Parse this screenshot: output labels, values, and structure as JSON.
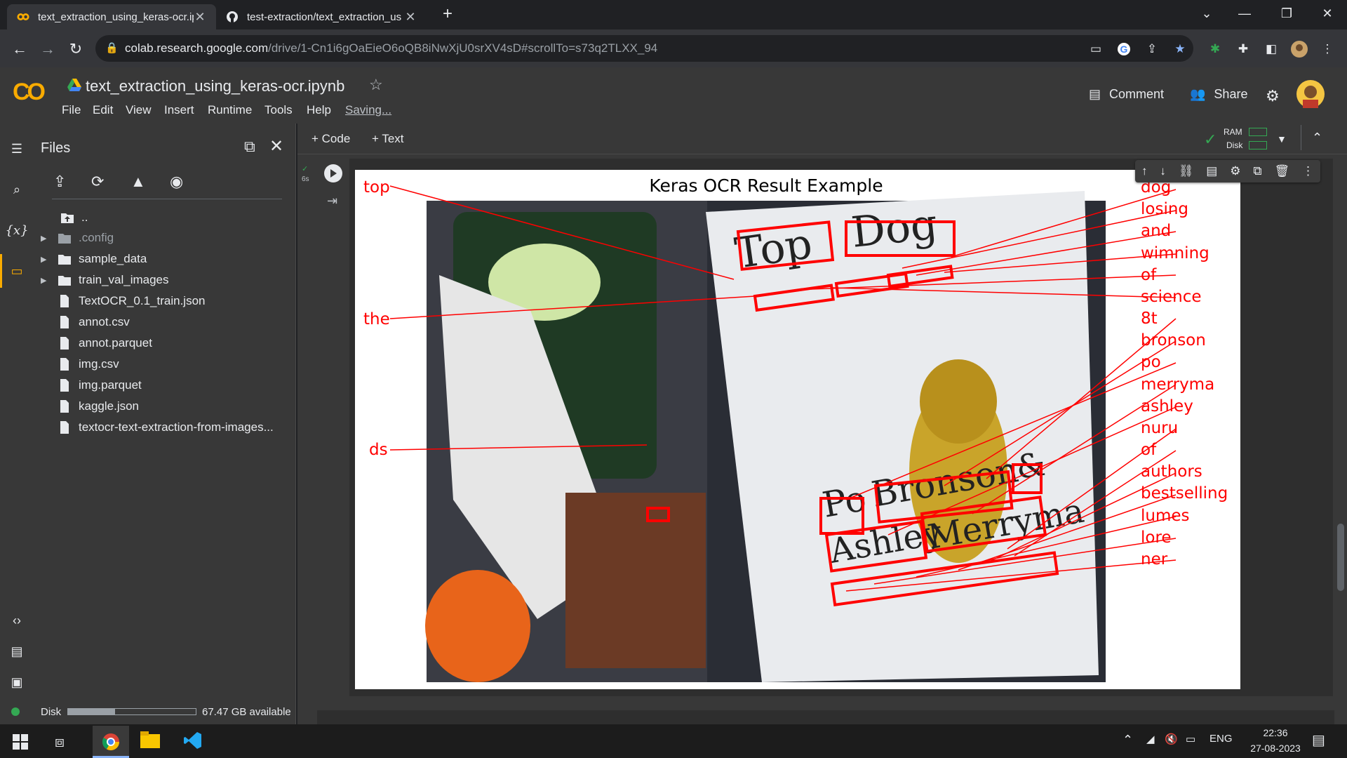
{
  "browser": {
    "tabs": [
      {
        "title": "text_extraction_using_keras-ocr.ip",
        "icon": "colab-icon",
        "active": true
      },
      {
        "title": "test-extraction/text_extraction_us",
        "icon": "github-icon",
        "active": false
      }
    ],
    "new_tab": "+",
    "url_host": "colab.research.google.com",
    "url_path": "/drive/1-Cn1i6gOaEieO6oQB8iNwXjU0srXV4sD#scrollTo=s73q2TLXX_94"
  },
  "colab": {
    "logo": "CO",
    "notebook_title": "text_extraction_using_keras-ocr.ipynb",
    "menu": [
      "File",
      "Edit",
      "View",
      "Insert",
      "Runtime",
      "Tools",
      "Help"
    ],
    "saving": "Saving...",
    "comment": "Comment",
    "share": "Share",
    "add_code": "+ Code",
    "add_text": "+ Text",
    "ram": "RAM",
    "disk": "Disk",
    "exec_time": "6s"
  },
  "files_panel": {
    "title": "Files",
    "items": [
      {
        "name": "..",
        "type": "up"
      },
      {
        "name": ".config",
        "type": "folder",
        "expandable": true
      },
      {
        "name": "sample_data",
        "type": "folder",
        "expandable": true
      },
      {
        "name": "train_val_images",
        "type": "folder",
        "expandable": true
      },
      {
        "name": "TextOCR_0.1_train.json",
        "type": "file"
      },
      {
        "name": "annot.csv",
        "type": "file"
      },
      {
        "name": "annot.parquet",
        "type": "file"
      },
      {
        "name": "img.csv",
        "type": "file"
      },
      {
        "name": "img.parquet",
        "type": "file"
      },
      {
        "name": "kaggle.json",
        "type": "file"
      },
      {
        "name": "textocr-text-extraction-from-images...",
        "type": "file"
      }
    ],
    "disk_label": "Disk",
    "disk_available": "67.47 GB available",
    "disk_used_fraction": 0.37
  },
  "figure": {
    "title": "Keras OCR Result Example",
    "left_labels": [
      "top",
      "the",
      "ds"
    ],
    "right_labels": [
      "dog",
      "losing",
      "and",
      "wimning",
      "of",
      "science",
      "8t",
      "bronson",
      "po",
      "merryma",
      "ashley",
      "nuru",
      "of",
      "authors",
      "bestselling",
      "lumes",
      "lore",
      "ner"
    ],
    "book_words": [
      "Top",
      "Dog",
      "Po",
      "Bronson",
      "&",
      "Ashley",
      "Merryma"
    ]
  },
  "taskbar": {
    "lang": "ENG",
    "time": "22:36",
    "date": "27-08-2023"
  },
  "colors": {
    "accent_orange": "#f9ab00",
    "annotation_red": "#ff0000",
    "link_blue": "#8ab4f8"
  }
}
